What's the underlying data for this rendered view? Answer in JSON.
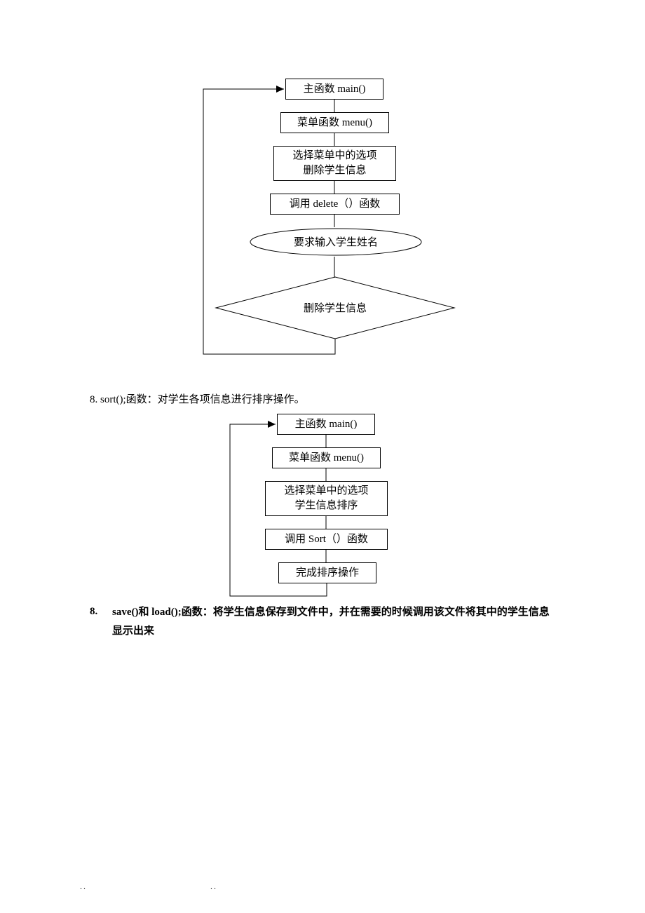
{
  "flow1": {
    "b1": "主函数 main()",
    "b2": "菜单函数 menu()",
    "b3": "选择菜单中的选项\n删除学生信息",
    "b4": "调用 delete（）函数",
    "b5": "要求输入学生姓名",
    "b6": "删除学生信息"
  },
  "section1": "8. sort();函数：对学生各项信息进行排序操作。",
  "flow2": {
    "b1": "主函数 main()",
    "b2": "菜单函数 menu()",
    "b3": "选择菜单中的选项\n学生信息排序",
    "b4": "调用 Sort（）函数",
    "b5": "完成排序操作"
  },
  "section2_num": "8.",
  "section2_text": "save()和 load();函数：将学生信息保存到文件中，并在需要的时候调用该文件将其中的学生信息显示出来",
  "footer1": "..",
  "footer2": ".."
}
